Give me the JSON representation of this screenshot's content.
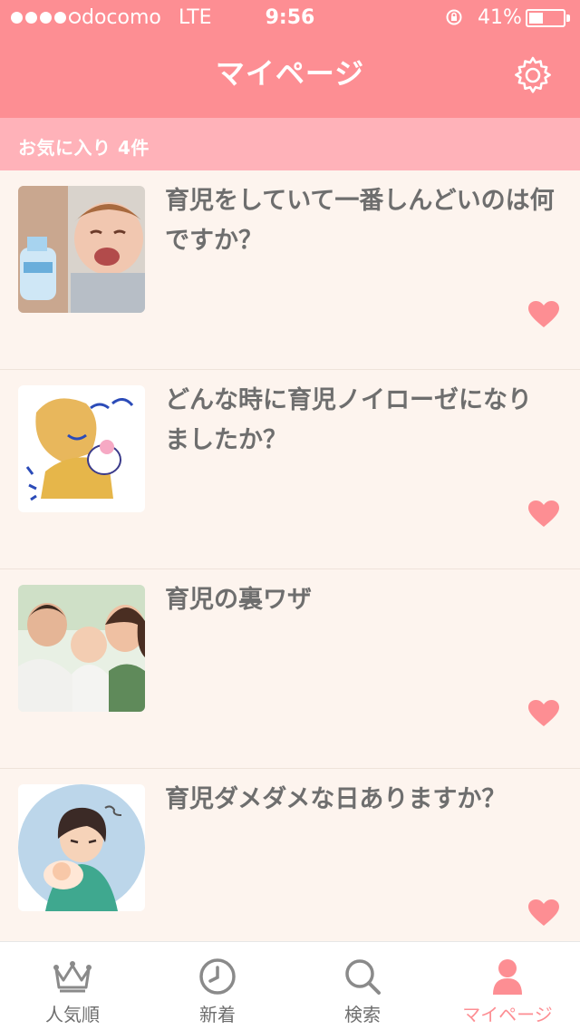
{
  "status_bar": {
    "carrier": "docomo",
    "network": "LTE",
    "time": "9:56",
    "battery_percent": "41%",
    "battery_level": 0.41
  },
  "nav": {
    "title": "マイページ",
    "settings_icon": "gear-icon"
  },
  "section": {
    "title": "お気に入り 4件"
  },
  "favorites": [
    {
      "title": "育児をしていて一番しんどいのは何ですか？",
      "thumbnail": "crying-baby-with-bottle",
      "favorited": true
    },
    {
      "title": "どんな時に育児ノイローゼになりましたか？",
      "thumbnail": "illustration-mother-and-crying-baby",
      "favorited": true
    },
    {
      "title": "育児の裏ワザ",
      "thumbnail": "family-smiling-with-baby",
      "favorited": true
    },
    {
      "title": "育児ダメダメな日ありますか？",
      "thumbnail": "tired-mother-holding-baby",
      "favorited": true
    }
  ],
  "tabs": [
    {
      "label": "人気順",
      "icon": "crown-icon",
      "active": false
    },
    {
      "label": "新着",
      "icon": "clock-icon",
      "active": false
    },
    {
      "label": "検索",
      "icon": "search-icon",
      "active": false
    },
    {
      "label": "マイページ",
      "icon": "person-icon",
      "active": true
    }
  ],
  "colors": {
    "accent": "#fd8e93",
    "section_header": "#ffb2b9",
    "background": "#fdf4ee",
    "text": "#6e6e6e",
    "inactive_icon": "#8a8a8a"
  }
}
